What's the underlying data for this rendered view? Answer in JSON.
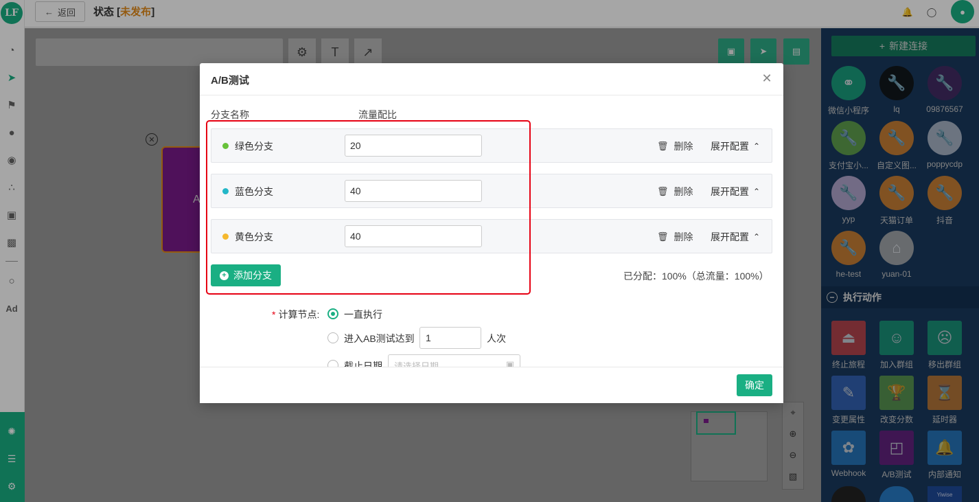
{
  "header": {
    "back_label": "返回",
    "status_prefix": "状态 [",
    "status_value": "未发布",
    "status_suffix": "]"
  },
  "logo": "LF",
  "canvas": {
    "node_label": "A"
  },
  "right_panel": {
    "new_connection_label": "新建连接",
    "connections": [
      {
        "label": "微信小程序",
        "color": "#1aaf83"
      },
      {
        "label": "lq",
        "color": "#111111"
      },
      {
        "label": "09876567",
        "color": "#4a2a66"
      },
      {
        "label": "支付宝小...",
        "color": "#6ab04c"
      },
      {
        "label": "自定义图...",
        "color": "#e58a2e"
      },
      {
        "label": "poppycdp",
        "color": "#c0c8d8"
      },
      {
        "label": "yyp",
        "color": "#cbb8e0"
      },
      {
        "label": "天猫订单",
        "color": "#e58a2e"
      },
      {
        "label": "抖音",
        "color": "#e58a2e"
      },
      {
        "label": "he-test",
        "color": "#e58a2e"
      },
      {
        "label": "yuan-01",
        "color": "#b8b8b8"
      }
    ],
    "actions_title": "执行动作",
    "actions": [
      {
        "label": "终止旅程",
        "color": "#e54848"
      },
      {
        "label": "加入群组",
        "color": "#1aaf83"
      },
      {
        "label": "移出群组",
        "color": "#1aaf83"
      },
      {
        "label": "变更属性",
        "color": "#3a6fcf"
      },
      {
        "label": "改变分数",
        "color": "#6ab04c"
      },
      {
        "label": "延时器",
        "color": "#e58a2e"
      },
      {
        "label": "Webhook",
        "color": "#2a88d8"
      },
      {
        "label": "A/B测试",
        "color": "#7a1b8b"
      },
      {
        "label": "内部通知",
        "color": "#2a88d8"
      }
    ],
    "partial_icon_text": "Yiwise"
  },
  "modal": {
    "title": "A/B测试",
    "col_branch": "分支名称",
    "col_ratio": "流量配比",
    "branches": [
      {
        "name": "绿色分支",
        "value": "20",
        "dot_color": "#67c23a"
      },
      {
        "name": "蓝色分支",
        "value": "40",
        "dot_color": "#23b7c8"
      },
      {
        "name": "黄色分支",
        "value": "40",
        "dot_color": "#f5b82e"
      }
    ],
    "delete_label": "删除",
    "expand_label": "展开配置",
    "add_branch_label": "添加分支",
    "allocated_text": "已分配：100%（总流量：100%）",
    "calc_label": "计算节点:",
    "option_always": "一直执行",
    "option_reach_prefix": "进入AB测试达到",
    "option_reach_value": "1",
    "option_reach_suffix": "人次",
    "option_deadline": "截止日期",
    "date_placeholder": "请选择日期",
    "confirm_label": "确定"
  }
}
